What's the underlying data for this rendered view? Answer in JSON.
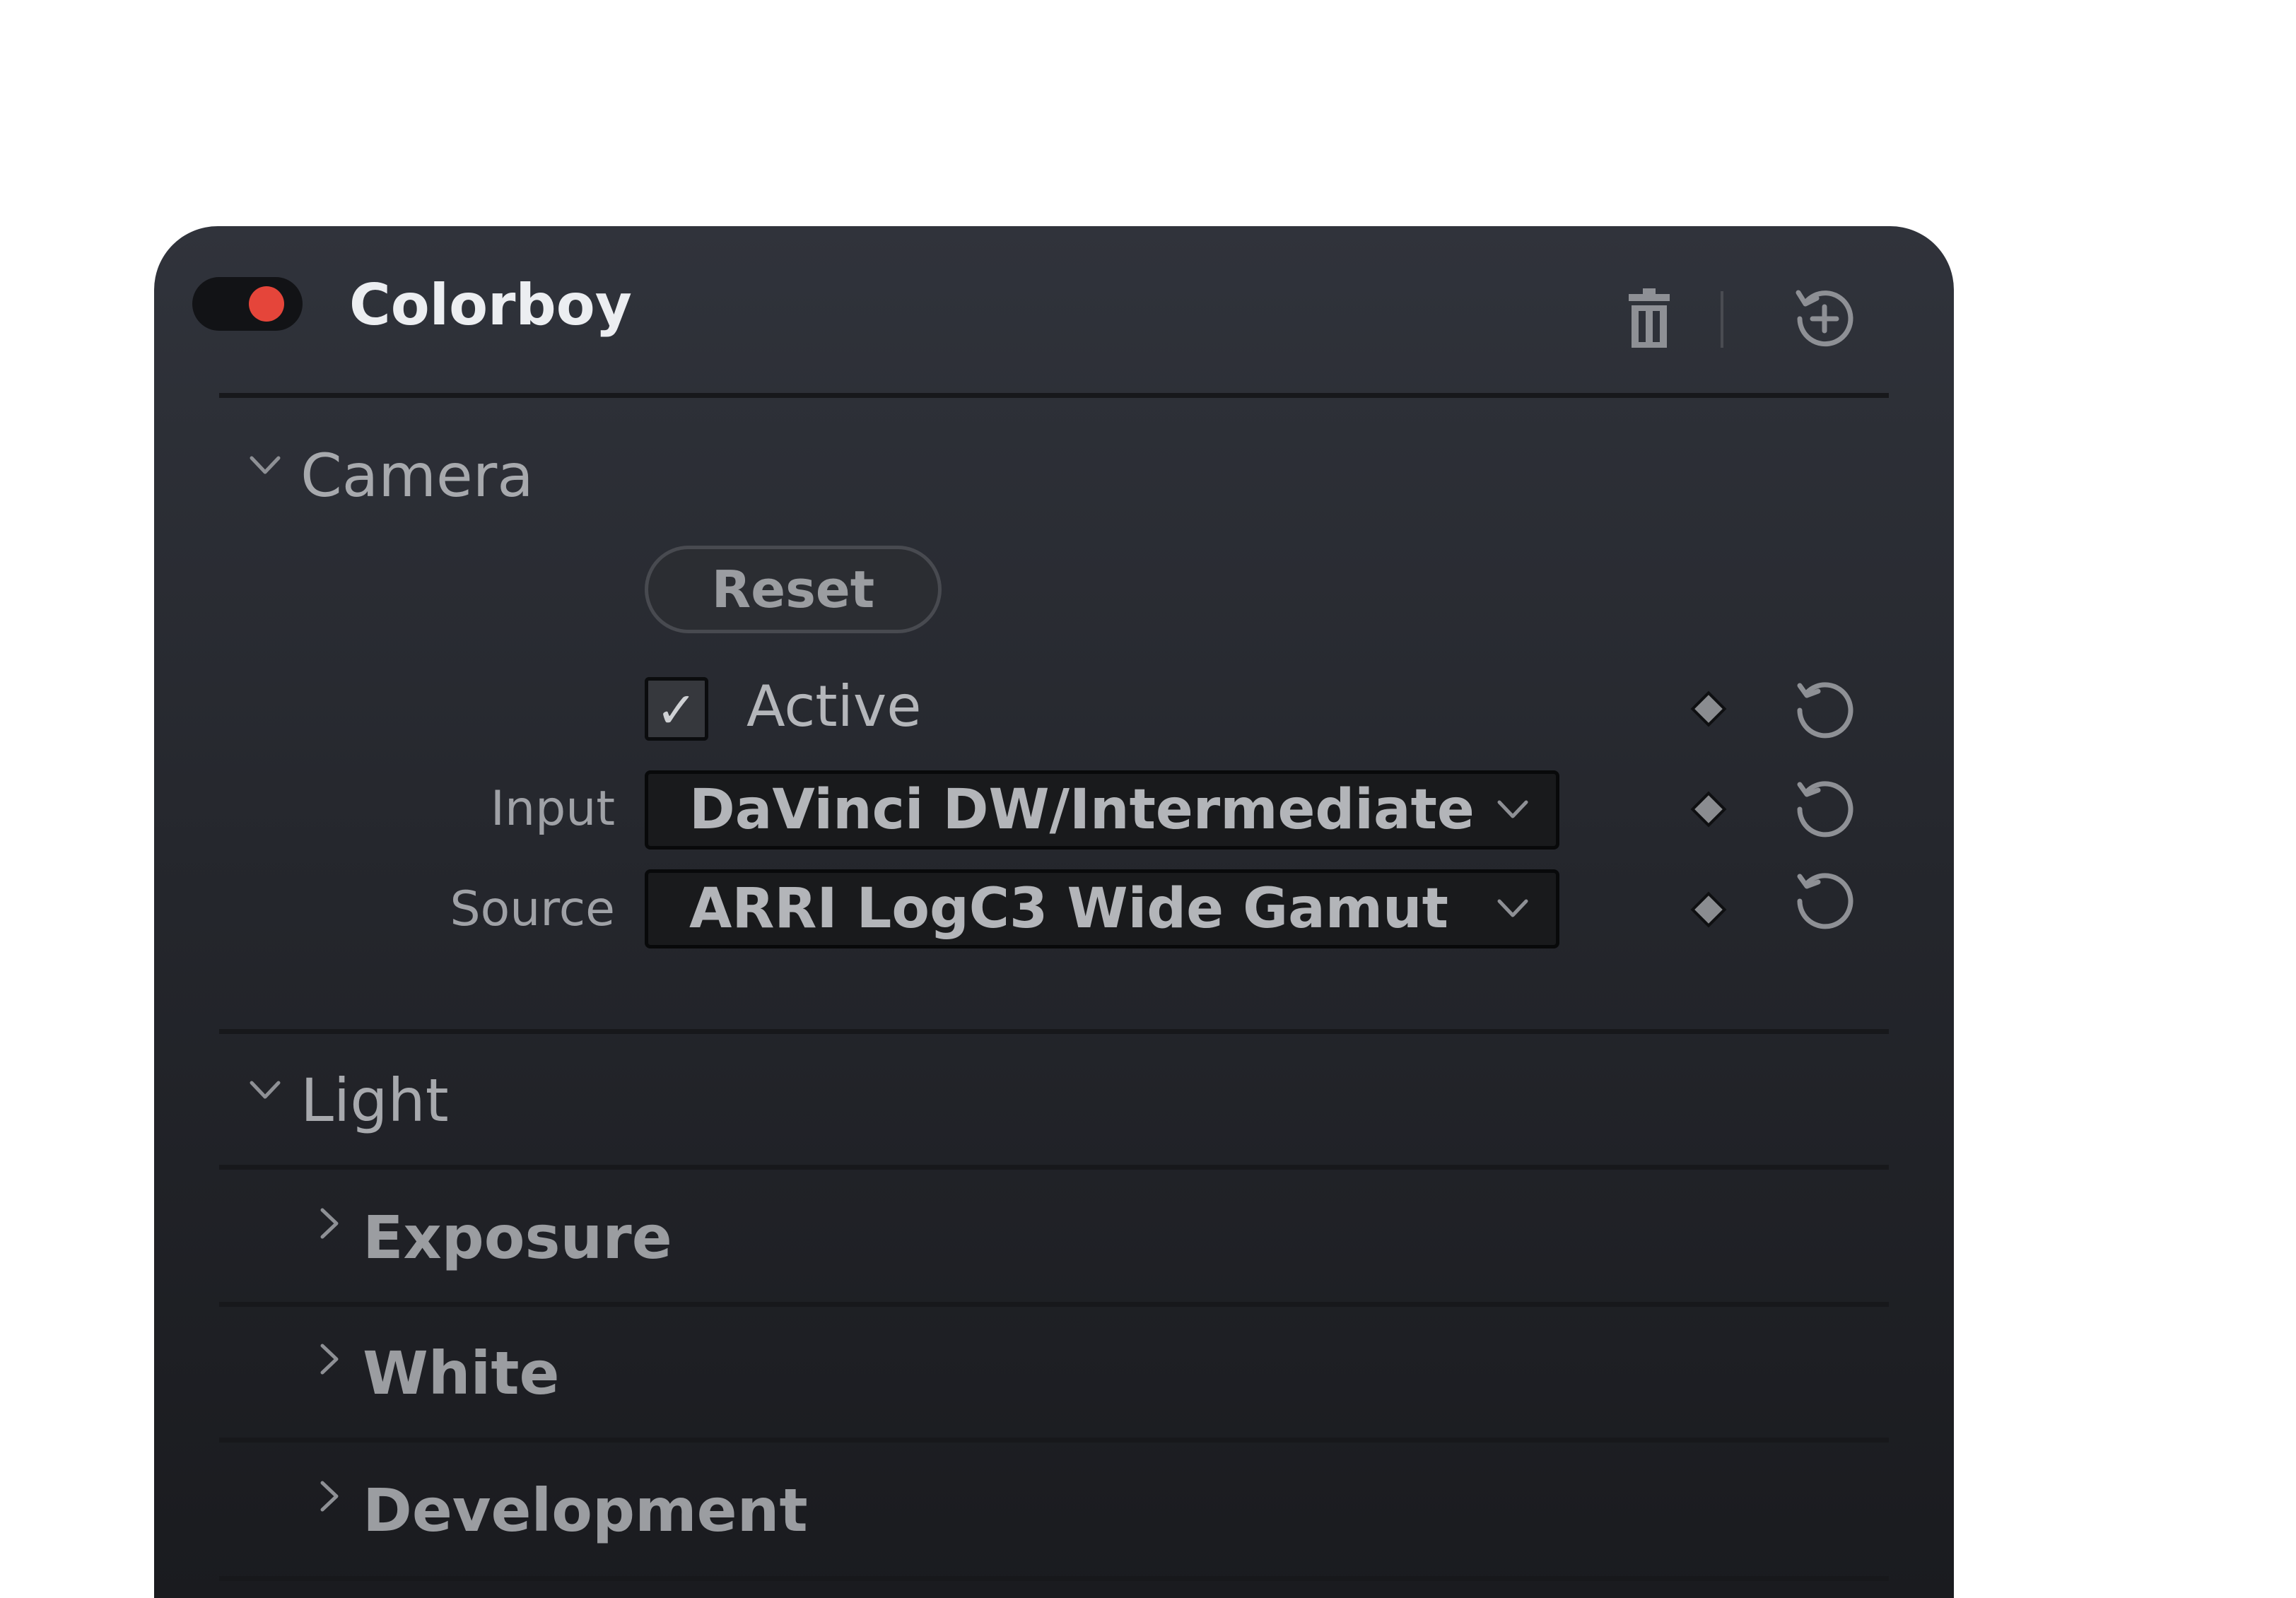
{
  "panel": {
    "title": "Colorboy",
    "enabled": true,
    "toggle_color": "#e5453a",
    "header_icons": [
      "trash-icon",
      "add-version-icon"
    ]
  },
  "camera": {
    "title": "Camera",
    "expanded": true,
    "reset_label": "Reset",
    "active": {
      "label": "Active",
      "checked": true,
      "check_glyph": "✓"
    },
    "input": {
      "label": "Input",
      "value": "DaVinci DW/Intermediate"
    },
    "source": {
      "label": "Source",
      "value": "ARRI LogC3 Wide Gamut"
    }
  },
  "light": {
    "title": "Light",
    "expanded": true,
    "subsections": [
      {
        "title": "Exposure",
        "expanded": false
      },
      {
        "title": "White",
        "expanded": false
      },
      {
        "title": "Development",
        "expanded": false
      }
    ]
  }
}
